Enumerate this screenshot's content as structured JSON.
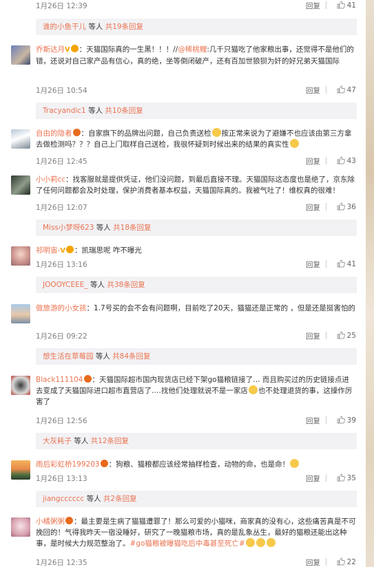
{
  "comments": [
    {
      "time": "1月26日 12:39",
      "reply": "回复",
      "likes": "41",
      "sub": {
        "user": "谁的小鱼干儿",
        "mid": " 等人 ",
        "count": "共19条回复"
      }
    },
    {
      "user": "乔斯达月",
      "sep": "：",
      "p1": "天猫国际真的一生黑！！！//",
      "mention": "@稀桃鲤",
      "p2": ":几千只猫吃了他家粮出事，还觉得不是他们的错，还说对自己家产品有信心，真的绝，坐等倒闭破产，还有百加世狼狈为奸的好兄弟天猫国际",
      "time": "1月26日 10:54",
      "reply": "回复",
      "likes": "47",
      "sub": {
        "user": "Tracyandic1",
        "mid": " 等人 ",
        "count": "共10条回复"
      }
    },
    {
      "user": "自由的隐者",
      "sep": "：",
      "p1": "自家旗下的品牌出问题，自己负责送检",
      "p2": "按正常来说为了避嫌不也应该由第三方拿去做检测吗？？？自己上门取样自己送检，我很怀疑到时候出来的结果的真实性",
      "time": "1月26日 12:45",
      "reply": "回复",
      "likes": "43"
    },
    {
      "user": "小小莉cc",
      "sep": "：",
      "p1": "找客服就是提供凭证，他们没问题，到最后直接不理。天猫国际这态度也是绝了，京东除了任何问题都会及时处理，保护消费者基本权益，天猫国际真的。我被气吐了！维权真的很难！",
      "time": "1月26日 12:07",
      "reply": "回复",
      "likes": "36",
      "sub": {
        "user": "Miss小梦呀623",
        "mid": " 等人 ",
        "count": "共18条回复"
      }
    },
    {
      "user": "祁明宙-",
      "sep": "：",
      "p1": "凯瑞思呢    咋不曝光",
      "time": "1月26日 13:16",
      "reply": "回复",
      "likes": "41",
      "sub": {
        "user": "JOOOYCEEE_",
        "mid": " 等人 ",
        "count": "共38条回复"
      }
    },
    {
      "user": "做旅游的小女孩",
      "sep": "：",
      "p1": "1.7号买的会不会有问题啊，目前吃了20天，猫猫还是正常的 ，但是还是挺害怕的",
      "time": "1月26日 09:22",
      "reply": "回复",
      "likes": "25",
      "sub": {
        "user": "想生活在草莓园",
        "mid": " 等人 ",
        "count": "共84条回复"
      }
    },
    {
      "user": "Black111104",
      "sep": "：",
      "p1": "天猫国际超市国内现货店已经下架go猫粮链接了… 而且购买过的历史链接点进去变成了天猫国际进口超市直营店了….找他们处理就说不是一家店",
      "p2": "也不处理退货的事，这操作厉害了",
      "time": "1月26日 12:56",
      "reply": "回复",
      "likes": "39",
      "sub": {
        "user": "大灰耗子",
        "mid": " 等人 ",
        "count": "共12条回复"
      }
    },
    {
      "user": "雨后彩虹桥199203",
      "sep": "：",
      "p1": "狗粮、猫粮都应该经常抽样检查，动物的命，也是命！",
      "time": "1月26日 13:13",
      "reply": "回复",
      "likes": "35",
      "sub": {
        "user": "jiangcccccc",
        "mid": " 等人 ",
        "count": "共2条回复"
      }
    },
    {
      "user": "小橘粥粥",
      "sep": "：",
      "p1": "最主要是生病了猫猫遭罪了！那么可爱的小猫咪，商家真的没有心，这些痛苦真是不可挽回的！气得我昨天一宿没睡好，研究了一晚猫粮市场，真的是乱象丛生，最好的猫粮还能出这种事，是时候大力规范整治了。",
      "hashtag": "#go猫粮被曝猫吃后中毒甚至死亡#",
      "time": "1月26日 12:35",
      "reply": "回复",
      "likes": "22"
    }
  ],
  "colors": {
    "link": "#eb7350",
    "text": "#333333",
    "meta": "#808080",
    "subbox": "#f2f2f5"
  },
  "icons": {
    "like": "thumbs-up-icon",
    "vip": "vip-badge-icon",
    "verified": "verified-v-icon",
    "emoji": "emoji-icon"
  }
}
